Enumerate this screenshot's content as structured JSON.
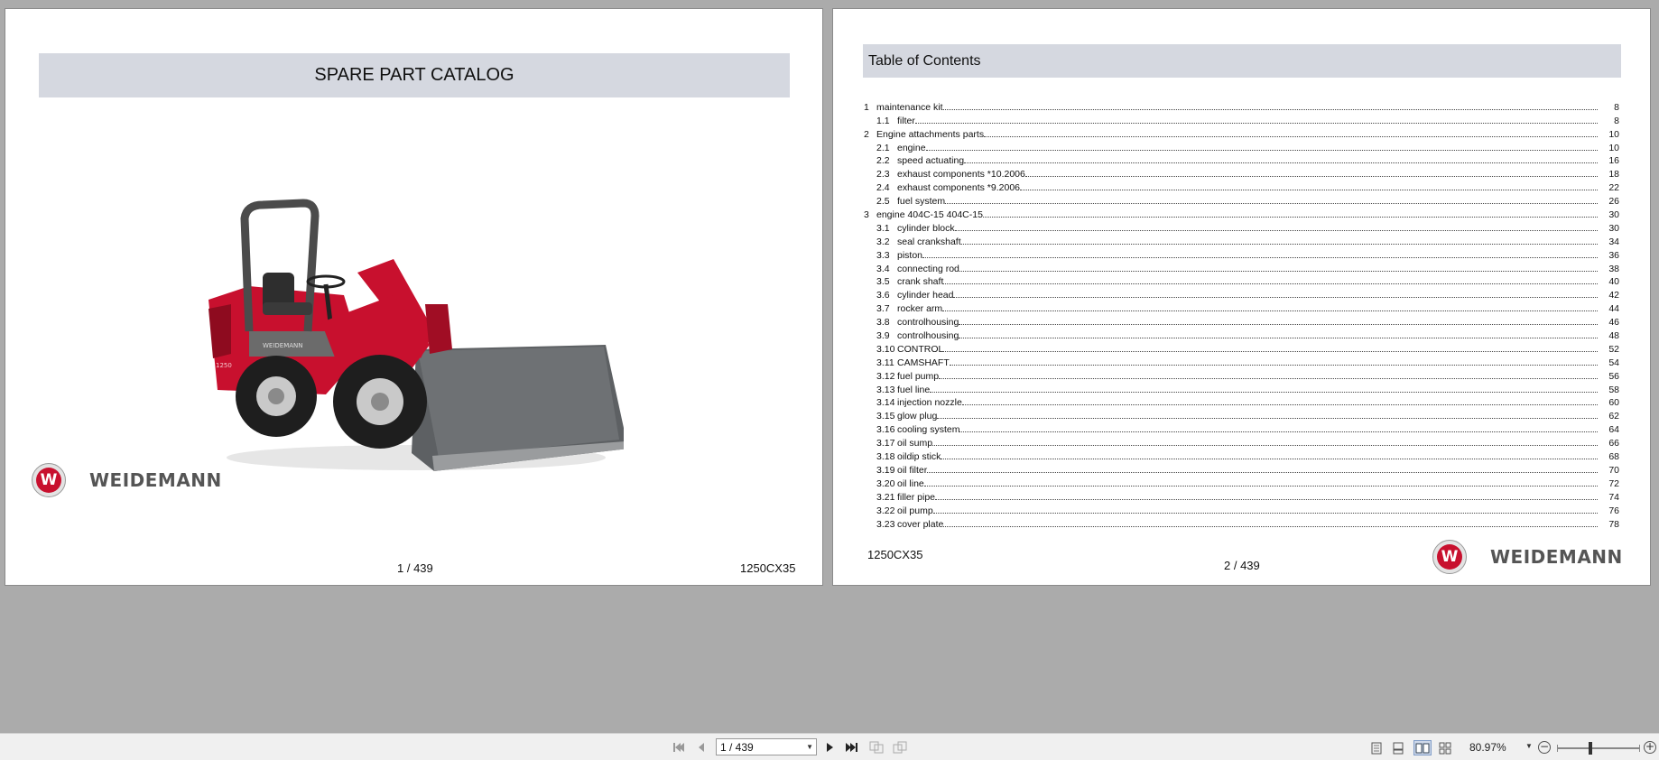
{
  "page1": {
    "title": "SPARE PART CATALOG",
    "brand": "WEIDEMANN",
    "brand_mark": "W",
    "page_label": "1 / 439",
    "model": "1250CX35",
    "image": {
      "name": "wheel-loader-image",
      "machine_label": "WEIDEMANN",
      "machine_number": "1250",
      "color_body": "#c8102e",
      "color_bucket": "#5d6063"
    }
  },
  "page2": {
    "heading": "Table of Contents",
    "model": "1250CX35",
    "page_label": "2 / 439",
    "brand": "WEIDEMANN",
    "brand_mark": "W",
    "toc": [
      {
        "num": "1",
        "title": "maintenance kit",
        "page": "8",
        "level": 1
      },
      {
        "num": "1.1",
        "title": "filter",
        "page": "8",
        "level": 2
      },
      {
        "num": "2",
        "title": "Engine attachments parts",
        "page": "10",
        "level": 1
      },
      {
        "num": "2.1",
        "title": "engine",
        "page": "10",
        "level": 2
      },
      {
        "num": "2.2",
        "title": "speed actuating",
        "page": "16",
        "level": 2
      },
      {
        "num": "2.3",
        "title": "exhaust components *10.2006",
        "page": "18",
        "level": 2
      },
      {
        "num": "2.4",
        "title": "exhaust components *9.2006",
        "page": "22",
        "level": 2
      },
      {
        "num": "2.5",
        "title": "fuel system",
        "page": "26",
        "level": 2
      },
      {
        "num": "3",
        "title": "engine 404C-15 404C-15",
        "page": "30",
        "level": 1
      },
      {
        "num": "3.1",
        "title": "cylinder block",
        "page": "30",
        "level": 2
      },
      {
        "num": "3.2",
        "title": "seal crankshaft",
        "page": "34",
        "level": 2
      },
      {
        "num": "3.3",
        "title": "piston",
        "page": "36",
        "level": 2
      },
      {
        "num": "3.4",
        "title": "connecting rod",
        "page": "38",
        "level": 2
      },
      {
        "num": "3.5",
        "title": "crank shaft",
        "page": "40",
        "level": 2
      },
      {
        "num": "3.6",
        "title": "cylinder head",
        "page": "42",
        "level": 2
      },
      {
        "num": "3.7",
        "title": "rocker arm",
        "page": "44",
        "level": 2
      },
      {
        "num": "3.8",
        "title": "controlhousing",
        "page": "46",
        "level": 2
      },
      {
        "num": "3.9",
        "title": "controlhousing",
        "page": "48",
        "level": 2
      },
      {
        "num": "3.10",
        "title": "CONTROL",
        "page": "52",
        "level": 2
      },
      {
        "num": "3.11",
        "title": "CAMSHAFT",
        "page": "54",
        "level": 2
      },
      {
        "num": "3.12",
        "title": "fuel pump",
        "page": "56",
        "level": 2
      },
      {
        "num": "3.13",
        "title": "fuel line",
        "page": "58",
        "level": 2
      },
      {
        "num": "3.14",
        "title": "injection nozzle",
        "page": "60",
        "level": 2
      },
      {
        "num": "3.15",
        "title": "glow plug",
        "page": "62",
        "level": 2
      },
      {
        "num": "3.16",
        "title": "cooling system",
        "page": "64",
        "level": 2
      },
      {
        "num": "3.17",
        "title": "oil sump",
        "page": "66",
        "level": 2
      },
      {
        "num": "3.18",
        "title": "oildip stick",
        "page": "68",
        "level": 2
      },
      {
        "num": "3.19",
        "title": "oil filter",
        "page": "70",
        "level": 2
      },
      {
        "num": "3.20",
        "title": "oil line",
        "page": "72",
        "level": 2
      },
      {
        "num": "3.21",
        "title": "filler pipe",
        "page": "74",
        "level": 2
      },
      {
        "num": "3.22",
        "title": "oil pump",
        "page": "76",
        "level": 2
      },
      {
        "num": "3.23",
        "title": "cover plate",
        "page": "78",
        "level": 2
      }
    ]
  },
  "toolbar": {
    "first_icon": "first-page-icon",
    "prev_icon": "previous-page-icon",
    "page_input_value": "1 / 439",
    "next_icon": "next-page-icon",
    "last_icon": "last-page-icon",
    "zoom_value": "80.97%",
    "zoom_out_symbol": "−",
    "zoom_in_symbol": "+",
    "active_view_mode": "two-page"
  }
}
